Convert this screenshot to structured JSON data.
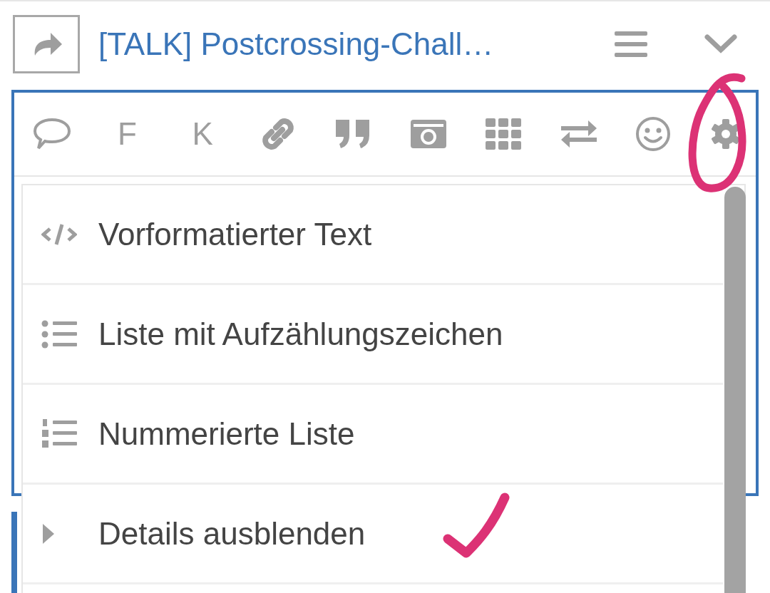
{
  "header": {
    "title": "[TALK] Postcrossing-Chall…"
  },
  "toolbar": {
    "letters": [
      "F",
      "K"
    ],
    "settings_circled": true
  },
  "menu": [
    {
      "kind": "code",
      "label": "Vorformatierter Text",
      "ticked": false
    },
    {
      "kind": "bullets",
      "label": "Liste mit Aufzählungszeichen",
      "ticked": false
    },
    {
      "kind": "numbers",
      "label": "Nummerierte Liste",
      "ticked": false
    },
    {
      "kind": "details",
      "label": "Details ausblenden",
      "ticked": true
    }
  ]
}
